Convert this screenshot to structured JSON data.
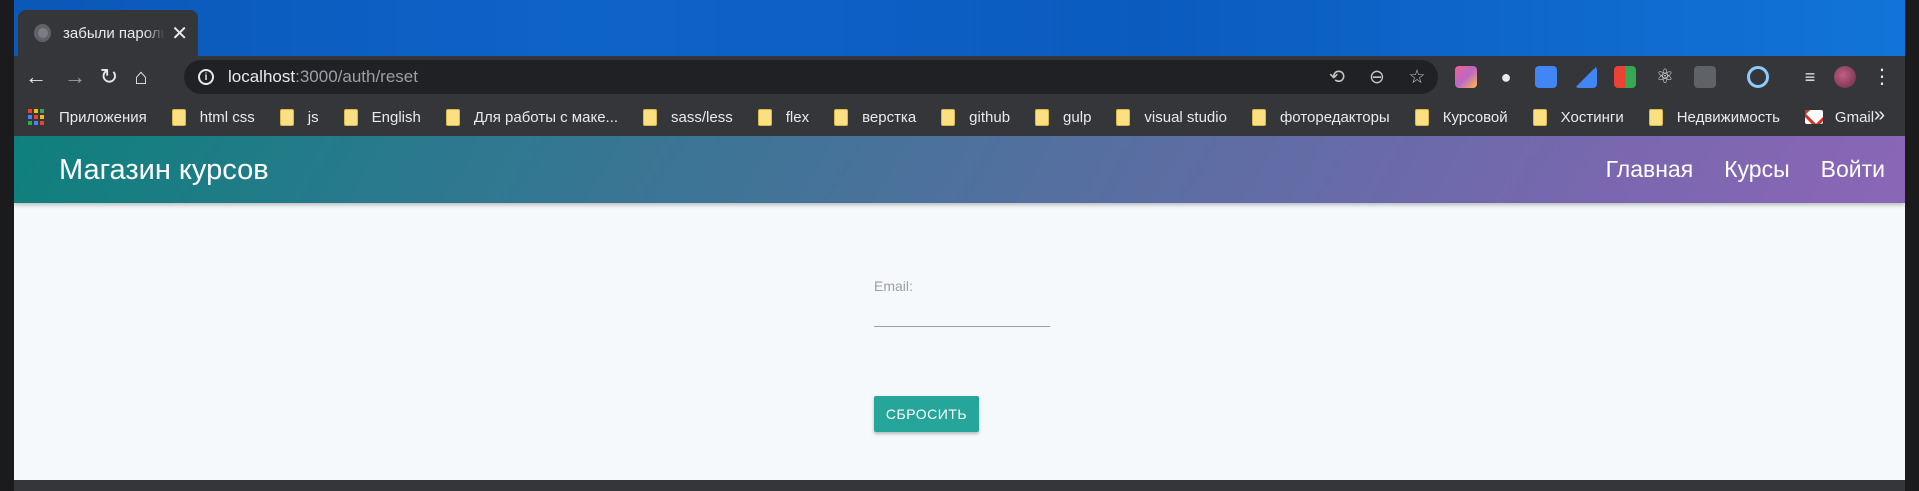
{
  "browser": {
    "tab": {
      "title": "забыли пароль",
      "close_glyph": "✕"
    },
    "nav": {
      "back": "←",
      "forward": "→",
      "reload": "↻",
      "home": "⌂"
    },
    "address": {
      "host": "localhost",
      "path": ":3000/auth/reset"
    },
    "omnibox_icons": [
      "translate-icon",
      "zoom-out-icon",
      "bookmark-star-icon"
    ],
    "bookmarks": [
      {
        "label": "Приложения",
        "icon": "apps-icon"
      },
      {
        "label": "html css",
        "icon": "folder-icon"
      },
      {
        "label": "js",
        "icon": "folder-icon"
      },
      {
        "label": "English",
        "icon": "folder-icon"
      },
      {
        "label": "Для работы с маке...",
        "icon": "folder-icon"
      },
      {
        "label": "sass/less",
        "icon": "folder-icon"
      },
      {
        "label": "flex",
        "icon": "folder-icon"
      },
      {
        "label": "верстка",
        "icon": "folder-icon"
      },
      {
        "label": "github",
        "icon": "folder-icon"
      },
      {
        "label": "gulp",
        "icon": "folder-icon"
      },
      {
        "label": "visual studio",
        "icon": "folder-icon"
      },
      {
        "label": "фоторедакторы",
        "icon": "folder-icon"
      },
      {
        "label": "Курсовой",
        "icon": "folder-icon"
      },
      {
        "label": "Хостинги",
        "icon": "folder-icon"
      },
      {
        "label": "Недвижимость",
        "icon": "folder-icon"
      },
      {
        "label": "Gmail",
        "icon": "gmail-icon"
      }
    ],
    "more_bookmarks": "»"
  },
  "site": {
    "brand": "Магазин курсов",
    "nav": {
      "home": "Главная",
      "courses": "Курсы",
      "login": "Войти"
    },
    "form": {
      "email_label": "Email:",
      "email_value": "",
      "submit_label": "СБРОСИТЬ"
    }
  },
  "colors": {
    "accent": "#26a69a",
    "navbar_start": "#0e807c",
    "navbar_end": "#8b66b7",
    "page_bg": "#f5f9fc"
  }
}
